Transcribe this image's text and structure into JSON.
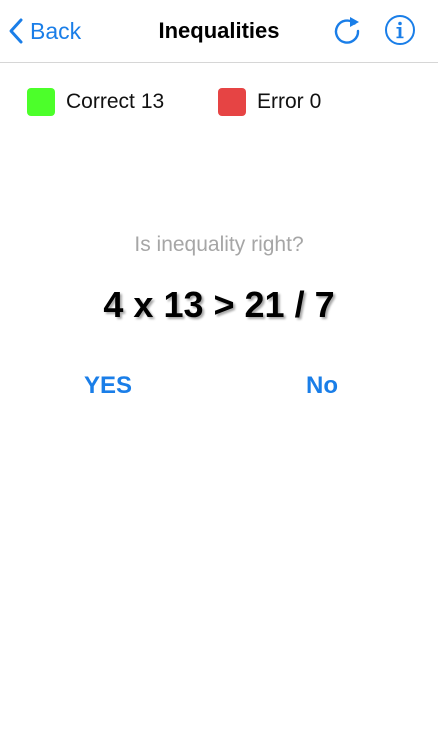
{
  "navbar": {
    "back_label": "Back",
    "title": "Inequalities",
    "icons": {
      "back": "chevron-left-icon",
      "refresh": "refresh-icon",
      "info": "info-icon"
    }
  },
  "score": {
    "correct_label": "Correct",
    "correct_count": "13",
    "error_label": "Error",
    "error_count": "0"
  },
  "question": {
    "prompt": "Is inequality right?",
    "expression": "4 x 13 > 21 / 7"
  },
  "answers": {
    "yes_label": "YES",
    "no_label": "No"
  },
  "colors": {
    "accent": "#1a7ee8",
    "correct": "#4cff2a",
    "error": "#e64444",
    "prompt": "#a6a6a6"
  }
}
